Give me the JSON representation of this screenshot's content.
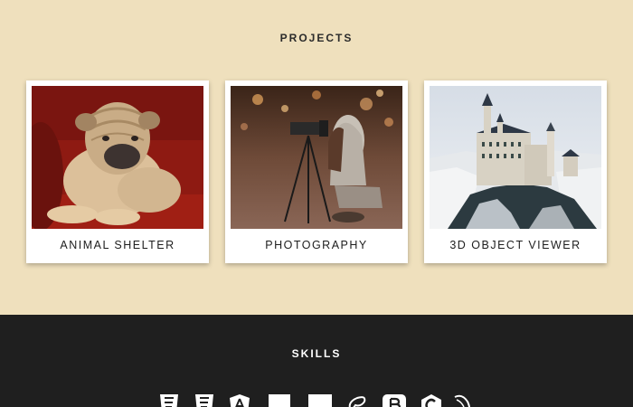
{
  "projects": {
    "title": "PROJECTS",
    "items": [
      {
        "label": "ANIMAL SHELTER",
        "image": "shar-pei-puppy-on-red-couch"
      },
      {
        "label": "PHOTOGRAPHY",
        "image": "photographer-with-tripod-on-street-at-night"
      },
      {
        "label": "3D OBJECT VIEWER",
        "image": "castle-on-snowy-forest-hill"
      }
    ]
  },
  "skills": {
    "title": "SKILLS",
    "icons": [
      "html5-icon",
      "css3-icon",
      "angular-icon",
      "javascript-icon",
      "typescript-icon",
      "sass-icon",
      "bootstrap-icon",
      "csharp-icon",
      "mysql-icon"
    ]
  },
  "colors": {
    "projects_bg": "#efe0bd",
    "skills_bg": "#1f1f1f",
    "card_bg": "#ffffff"
  }
}
